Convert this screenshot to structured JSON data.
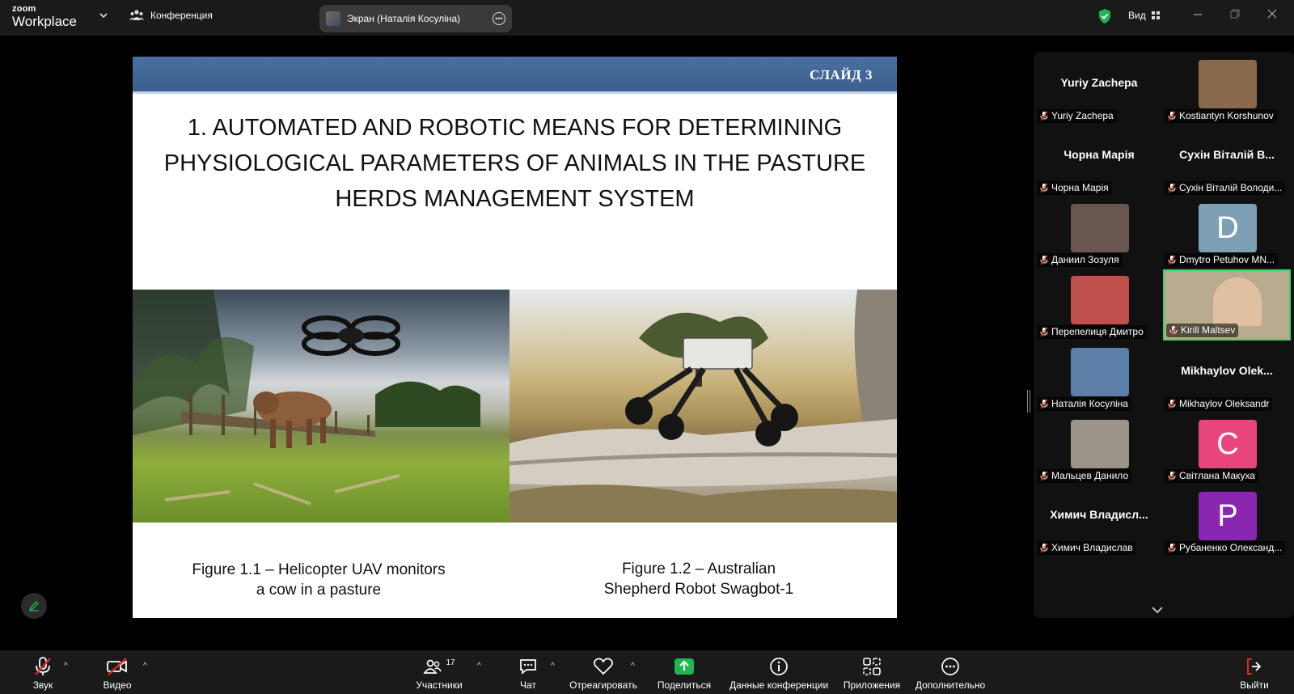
{
  "app": {
    "brand_top": "zoom",
    "brand_bottom": "Workplace",
    "conference_label": "Конференция",
    "screen_share_label": "Экран (Наталія Косуліна)",
    "view_label": "Вид"
  },
  "slide": {
    "number_label": "СЛАЙД 3",
    "title": "1. AUTOMATED AND ROBOTIC MEANS FOR DETERMINING PHYSIOLOGICAL PARAMETERS OF ANIMALS IN THE PASTURE HERDS MANAGEMENT SYSTEM",
    "caption_1_line1": "Figure 1.1 – Helicopter UAV monitors",
    "caption_1_line2": "a cow in a pasture",
    "caption_2_line1": "Figure 1.2 – Australian",
    "caption_2_line2": "Shepherd Robot Swagbot-1"
  },
  "participants": [
    {
      "display": "Yuriy Zachepa",
      "label": "Yuriy Zachepa",
      "kind": "name"
    },
    {
      "display": "",
      "label": "Kostiantyn Korshunov",
      "kind": "photo",
      "color": "#8a6a4c"
    },
    {
      "display": "Чорна Марія",
      "label": "Чорна Марія",
      "kind": "name"
    },
    {
      "display": "Сухін Віталій В...",
      "label": "Сухін Віталій Володи...",
      "kind": "name"
    },
    {
      "display": "",
      "label": "Даниил Зозуля",
      "kind": "photo",
      "color": "#6a5650"
    },
    {
      "display": "D",
      "label": "Dmytro Petuhov MN...",
      "kind": "letter",
      "color": "#7da0b5"
    },
    {
      "display": "",
      "label": "Перепелиця Дмитро",
      "kind": "photo",
      "color": "#c0504d"
    },
    {
      "display": "",
      "label": "Kirill Maltsev",
      "kind": "video",
      "color": "#b9ab8f"
    },
    {
      "display": "",
      "label": "Наталія Косуліна",
      "kind": "photo",
      "color": "#5c7fa8"
    },
    {
      "display": "Mikhaylov  Olek...",
      "label": "Mikhaylov Oleksandr",
      "kind": "name"
    },
    {
      "display": "",
      "label": "Мальцев Данило",
      "kind": "photo",
      "color": "#9b9488"
    },
    {
      "display": "C",
      "label": "Світлана Макуха",
      "kind": "letter",
      "color": "#e8457c"
    },
    {
      "display": "Химич  Владисл...",
      "label": "Химич Владислав",
      "kind": "name"
    },
    {
      "display": "P",
      "label": "Рубаненко Олександ...",
      "kind": "letter",
      "color": "#8a27b0"
    }
  ],
  "toolbar": {
    "audio": "Звук",
    "video": "Видео",
    "participants": "Участники",
    "participants_count": "17",
    "chat": "Чат",
    "react": "Отреагировать",
    "share": "Поделиться",
    "meeting_info": "Данные конференции",
    "apps": "Приложения",
    "more": "Дополнительно",
    "leave": "Выйти"
  },
  "colors": {
    "share_green": "#1fb553",
    "leave_red": "#e02828",
    "slide_header": "#3f6291",
    "active_speaker": "#3ad36a"
  }
}
